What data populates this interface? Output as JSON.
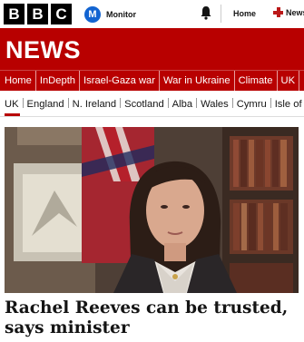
{
  "masthead": {
    "logo_letters": [
      "B",
      "B",
      "C"
    ],
    "monitor_badge": "M",
    "monitor_label": "Monitor",
    "bell_icon": "bell-icon",
    "home_label": "Home",
    "news_label": "News"
  },
  "banner": {
    "title": "NEWS"
  },
  "primary_nav": [
    "Home",
    "InDepth",
    "Israel-Gaza war",
    "War in Ukraine",
    "Climate",
    "UK"
  ],
  "secondary_nav": [
    "UK",
    "England",
    "N. Ireland",
    "Scotland",
    "Alba",
    "Wales",
    "Cymru",
    "Isle of Man"
  ],
  "secondary_nav_active": "UK",
  "article": {
    "headline": "Rachel Reeves can be trusted, says minister"
  },
  "colors": {
    "brand_red": "#b80000",
    "monitor_blue": "#1264d1"
  }
}
